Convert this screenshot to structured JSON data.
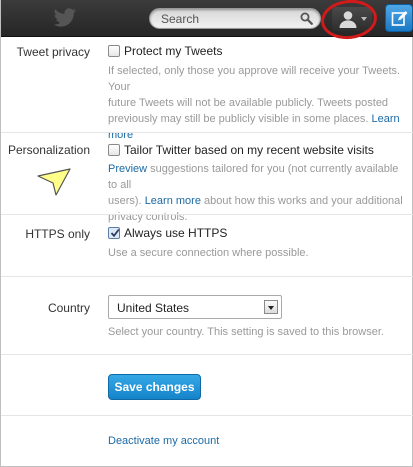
{
  "topbar": {
    "search": {
      "placeholder": "Search"
    }
  },
  "settings": {
    "tweet_privacy": {
      "label": "Tweet privacy",
      "checkbox_label": "Protect my Tweets",
      "checked": false,
      "help_lines": [
        "If selected, only those you approve will receive your Tweets. Your",
        "future Tweets will not be available publicly. Tweets posted",
        "previously may still be publicly visible in some places."
      ],
      "learn_more_1": "Learn",
      "learn_more_2": "more"
    },
    "personalization": {
      "label": "Personalization",
      "checkbox_label": "Tailor Twitter based on my recent website visits",
      "checked": false,
      "preview_link": "Preview",
      "help_line1": " suggestions tailored for you (not currently available to all",
      "help_line2_pre": "users). ",
      "learn_more": "Learn more",
      "help_line2_post": " about how this works and your additional",
      "help_line3": "privacy controls."
    },
    "https": {
      "label": "HTTPS only",
      "checkbox_label": "Always use HTTPS",
      "checked": true,
      "help": "Use a secure connection where possible."
    },
    "country": {
      "label": "Country",
      "selected": "United States",
      "help": "Select your country. This setting is saved to this browser."
    }
  },
  "actions": {
    "save_label": "Save changes",
    "deactivate_label": "Deactivate my account"
  },
  "colors": {
    "accent_blue": "#1b6aa5",
    "button_blue": "#1583c9",
    "highlight_red": "#d11a1a",
    "pointer_yellow": "#ffff8a"
  }
}
